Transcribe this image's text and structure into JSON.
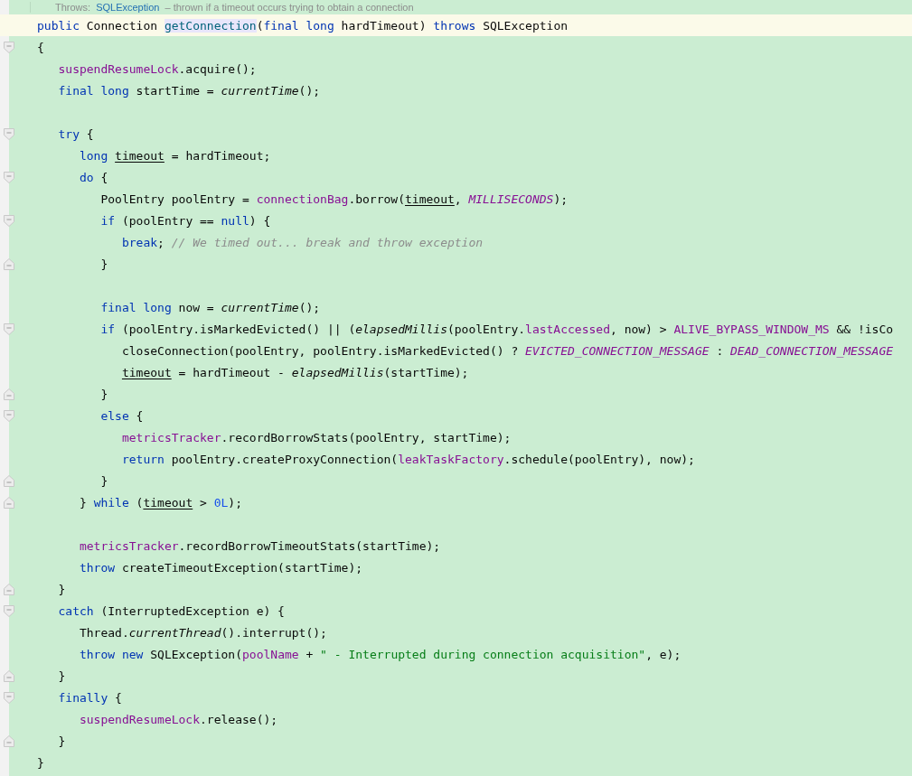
{
  "doc_comment": {
    "label": "Throws:",
    "link": "SQLException",
    "text": "– thrown if a timeout occurs trying to obtain a connection"
  },
  "lines": [
    {
      "kind": "current_line",
      "tokens": [
        {
          "kind": "keyword",
          "text": "public"
        },
        {
          "kind": "plain",
          "text": " Connection "
        },
        {
          "kind": "declaration",
          "text": "getConnection"
        },
        {
          "kind": "plain",
          "text": "("
        },
        {
          "kind": "keyword",
          "text": "final long"
        },
        {
          "kind": "plain",
          "text": " hardTimeout) "
        },
        {
          "kind": "keyword",
          "text": "throws"
        },
        {
          "kind": "plain",
          "text": " SQLException"
        }
      ]
    },
    {
      "kind": "fold_start",
      "tokens": [
        {
          "kind": "plain",
          "text": "{"
        }
      ]
    },
    {
      "kind": "code",
      "tokens": [
        {
          "kind": "field",
          "text": "   suspendResumeLock"
        },
        {
          "kind": "plain",
          "text": ".acquire();"
        }
      ]
    },
    {
      "kind": "code",
      "tokens": [
        {
          "kind": "keyword",
          "text": "   final long"
        },
        {
          "kind": "plain",
          "text": " startTime = "
        },
        {
          "kind": "static",
          "text": "currentTime"
        },
        {
          "kind": "plain",
          "text": "();"
        }
      ]
    },
    {
      "kind": "blank"
    },
    {
      "kind": "fold_start",
      "tokens": [
        {
          "kind": "keyword",
          "text": "   try"
        },
        {
          "kind": "plain",
          "text": " {"
        }
      ]
    },
    {
      "kind": "code",
      "tokens": [
        {
          "kind": "keyword",
          "text": "      long"
        },
        {
          "kind": "reassigned",
          "text": " timeout"
        },
        {
          "kind": "plain",
          "text": " = hardTimeout;"
        }
      ]
    },
    {
      "kind": "fold_start",
      "tokens": [
        {
          "kind": "keyword",
          "text": "      do"
        },
        {
          "kind": "plain",
          "text": " {"
        }
      ]
    },
    {
      "kind": "code",
      "tokens": [
        {
          "kind": "plain",
          "text": "         PoolEntry poolEntry = "
        },
        {
          "kind": "field",
          "text": "connectionBag"
        },
        {
          "kind": "plain",
          "text": ".borrow("
        },
        {
          "kind": "reassigned",
          "text": "timeout"
        },
        {
          "kind": "plain",
          "text": ", "
        },
        {
          "kind": "constant",
          "text": "MILLISECONDS"
        },
        {
          "kind": "plain",
          "text": ");"
        }
      ]
    },
    {
      "kind": "fold_start",
      "tokens": [
        {
          "kind": "keyword",
          "text": "         if"
        },
        {
          "kind": "plain",
          "text": " (poolEntry == "
        },
        {
          "kind": "keyword",
          "text": "null"
        },
        {
          "kind": "plain",
          "text": ") {"
        }
      ]
    },
    {
      "kind": "code",
      "tokens": [
        {
          "kind": "keyword",
          "text": "            break"
        },
        {
          "kind": "plain",
          "text": "; "
        },
        {
          "kind": "comment",
          "text": "// We timed out... break and throw exception"
        }
      ]
    },
    {
      "kind": "fold_end",
      "tokens": [
        {
          "kind": "plain",
          "text": "         }"
        }
      ]
    },
    {
      "kind": "blank"
    },
    {
      "kind": "code",
      "tokens": [
        {
          "kind": "keyword",
          "text": "         final long"
        },
        {
          "kind": "plain",
          "text": " now = "
        },
        {
          "kind": "static",
          "text": "currentTime"
        },
        {
          "kind": "plain",
          "text": "();"
        }
      ]
    },
    {
      "kind": "fold_start",
      "tokens": [
        {
          "kind": "keyword",
          "text": "         if"
        },
        {
          "kind": "plain",
          "text": " (poolEntry.isMarkedEvicted() || ("
        },
        {
          "kind": "static",
          "text": "elapsedMillis"
        },
        {
          "kind": "plain",
          "text": "(poolEntry."
        },
        {
          "kind": "field",
          "text": "lastAccessed"
        },
        {
          "kind": "plain",
          "text": ", now) > "
        },
        {
          "kind": "field",
          "text": "ALIVE_BYPASS_WINDOW_MS"
        },
        {
          "kind": "plain",
          "text": " && !isCo"
        }
      ]
    },
    {
      "kind": "code",
      "tokens": [
        {
          "kind": "plain",
          "text": "            closeConnection(poolEntry, poolEntry.isMarkedEvicted() ? "
        },
        {
          "kind": "constant",
          "text": "EVICTED_CONNECTION_MESSAGE"
        },
        {
          "kind": "plain",
          "text": " : "
        },
        {
          "kind": "constant",
          "text": "DEAD_CONNECTION_MESSAGE"
        }
      ]
    },
    {
      "kind": "code",
      "tokens": [
        {
          "kind": "reassigned",
          "text": "            timeout"
        },
        {
          "kind": "plain",
          "text": " = hardTimeout - "
        },
        {
          "kind": "static",
          "text": "elapsedMillis"
        },
        {
          "kind": "plain",
          "text": "(startTime);"
        }
      ]
    },
    {
      "kind": "fold_end",
      "tokens": [
        {
          "kind": "plain",
          "text": "         }"
        }
      ]
    },
    {
      "kind": "fold_start",
      "tokens": [
        {
          "kind": "keyword",
          "text": "         else"
        },
        {
          "kind": "plain",
          "text": " {"
        }
      ]
    },
    {
      "kind": "code",
      "tokens": [
        {
          "kind": "field",
          "text": "            metricsTracker"
        },
        {
          "kind": "plain",
          "text": ".recordBorrowStats(poolEntry, startTime);"
        }
      ]
    },
    {
      "kind": "code",
      "tokens": [
        {
          "kind": "keyword",
          "text": "            return"
        },
        {
          "kind": "plain",
          "text": " poolEntry.createProxyConnection("
        },
        {
          "kind": "field",
          "text": "leakTaskFactory"
        },
        {
          "kind": "plain",
          "text": ".schedule(poolEntry), now);"
        }
      ]
    },
    {
      "kind": "fold_end",
      "tokens": [
        {
          "kind": "plain",
          "text": "         }"
        }
      ]
    },
    {
      "kind": "fold_end",
      "tokens": [
        {
          "kind": "plain",
          "text": "      } "
        },
        {
          "kind": "keyword",
          "text": "while"
        },
        {
          "kind": "plain",
          "text": " ("
        },
        {
          "kind": "reassigned",
          "text": "timeout"
        },
        {
          "kind": "plain",
          "text": " > "
        },
        {
          "kind": "number",
          "text": "0L"
        },
        {
          "kind": "plain",
          "text": ");"
        }
      ]
    },
    {
      "kind": "blank"
    },
    {
      "kind": "code",
      "tokens": [
        {
          "kind": "field",
          "text": "      metricsTracker"
        },
        {
          "kind": "plain",
          "text": ".recordBorrowTimeoutStats(startTime);"
        }
      ]
    },
    {
      "kind": "code",
      "tokens": [
        {
          "kind": "keyword",
          "text": "      throw"
        },
        {
          "kind": "plain",
          "text": " createTimeoutException(startTime);"
        }
      ]
    },
    {
      "kind": "fold_end",
      "tokens": [
        {
          "kind": "plain",
          "text": "   }"
        }
      ]
    },
    {
      "kind": "fold_start",
      "tokens": [
        {
          "kind": "keyword",
          "text": "   catch"
        },
        {
          "kind": "plain",
          "text": " (InterruptedException e) {"
        }
      ]
    },
    {
      "kind": "code",
      "tokens": [
        {
          "kind": "plain",
          "text": "      Thread."
        },
        {
          "kind": "static",
          "text": "currentThread"
        },
        {
          "kind": "plain",
          "text": "().interrupt();"
        }
      ]
    },
    {
      "kind": "code",
      "tokens": [
        {
          "kind": "keyword",
          "text": "      throw new"
        },
        {
          "kind": "plain",
          "text": " SQLException("
        },
        {
          "kind": "field",
          "text": "poolName"
        },
        {
          "kind": "plain",
          "text": " + "
        },
        {
          "kind": "string",
          "text": "\" - Interrupted during connection acquisition\""
        },
        {
          "kind": "plain",
          "text": ", e);"
        }
      ]
    },
    {
      "kind": "fold_end",
      "tokens": [
        {
          "kind": "plain",
          "text": "   }"
        }
      ]
    },
    {
      "kind": "fold_start",
      "tokens": [
        {
          "kind": "keyword",
          "text": "   finally"
        },
        {
          "kind": "plain",
          "text": " {"
        }
      ]
    },
    {
      "kind": "code",
      "tokens": [
        {
          "kind": "field",
          "text": "      suspendResumeLock"
        },
        {
          "kind": "plain",
          "text": ".release();"
        }
      ]
    },
    {
      "kind": "fold_end",
      "tokens": [
        {
          "kind": "plain",
          "text": "   }"
        }
      ]
    },
    {
      "kind": "code",
      "tokens": [
        {
          "kind": "plain",
          "text": "}"
        }
      ]
    }
  ]
}
